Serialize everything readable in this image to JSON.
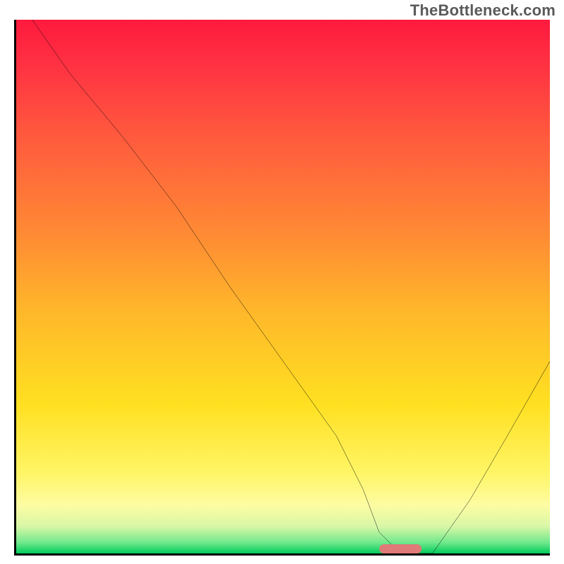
{
  "watermark": "TheBottleneck.com",
  "chart_data": {
    "type": "line",
    "title": "",
    "xlabel": "",
    "ylabel": "",
    "xlim": [
      0,
      100
    ],
    "ylim": [
      0,
      100
    ],
    "grid": false,
    "series": [
      {
        "name": "bottleneck-curve",
        "x": [
          3,
          10,
          20,
          30,
          40,
          50,
          60,
          65,
          68,
          72,
          78,
          85,
          92,
          100
        ],
        "values": [
          100,
          90,
          78,
          65,
          50,
          36,
          22,
          12,
          4,
          0,
          0,
          10,
          22,
          36
        ]
      }
    ],
    "annotations": [
      {
        "name": "optimal-marker",
        "x_start": 68,
        "x_end": 76,
        "y": 0,
        "color": "#e07a78"
      }
    ],
    "background_gradient": {
      "stops": [
        {
          "pos": 0.0,
          "color": "#ff1a3e"
        },
        {
          "pos": 0.4,
          "color": "#ff8a34"
        },
        {
          "pos": 0.72,
          "color": "#ffe021"
        },
        {
          "pos": 0.91,
          "color": "#fdfca3"
        },
        {
          "pos": 1.0,
          "color": "#00cc5a"
        }
      ]
    }
  }
}
